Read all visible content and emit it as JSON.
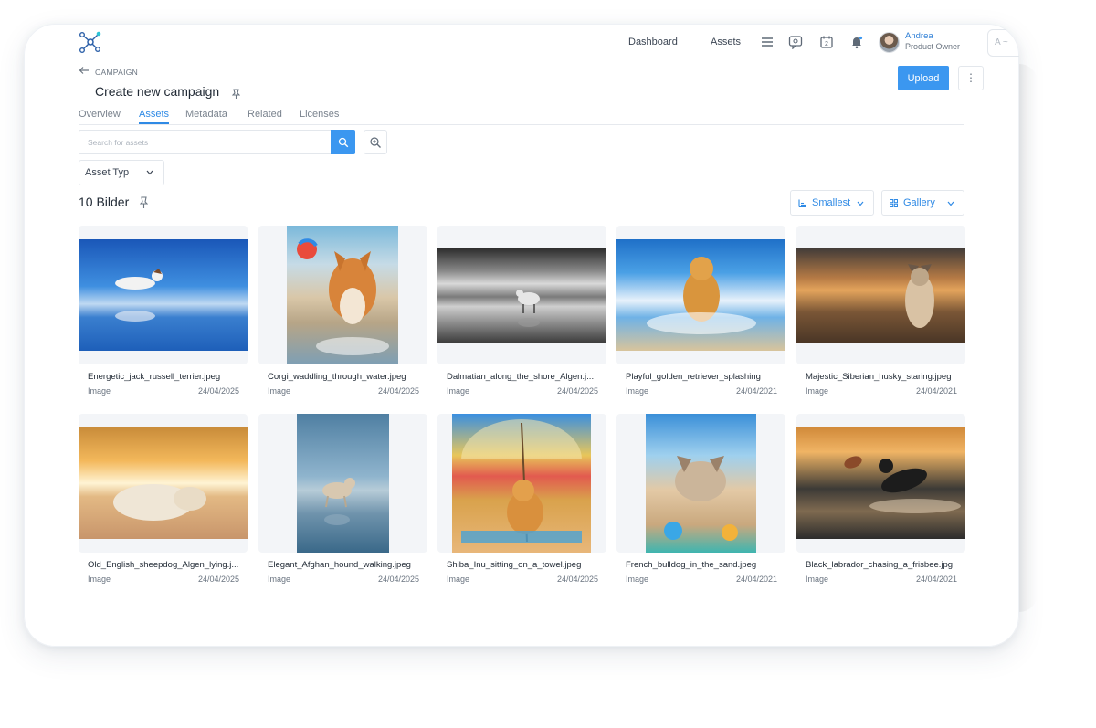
{
  "header": {
    "nav": [
      "Dashboard",
      "Assets"
    ],
    "user": {
      "name": "Andrea",
      "role": "Product Owner"
    },
    "language_pill": "A ~"
  },
  "breadcrumb": "CAMPAIGN",
  "page_title": "Create new campaign",
  "actions": {
    "upload": "Upload",
    "more": "⋮"
  },
  "tabs": [
    {
      "label": "Overview",
      "active": false
    },
    {
      "label": "Assets",
      "active": true
    },
    {
      "label": "Metadata",
      "active": false
    },
    {
      "label": "Related",
      "active": false
    },
    {
      "label": "Licenses",
      "active": false
    }
  ],
  "search": {
    "placeholder": "Search for assets"
  },
  "filters": {
    "asset_type": "Asset Typ"
  },
  "results": {
    "count_label": "10 Bilder",
    "sort": "Smallest",
    "view": "Gallery"
  },
  "assets": [
    {
      "filename": "Energetic_jack_russell_terrier.jpeg",
      "type": "Image",
      "date": "24/04/2025"
    },
    {
      "filename": "Corgi_waddling_through_water.jpeg",
      "type": "Image",
      "date": "24/04/2025"
    },
    {
      "filename": "Dalmatian_along_the_shore_Algen.j...",
      "type": "Image",
      "date": "24/04/2025"
    },
    {
      "filename": "Playful_golden_retriever_splashing",
      "type": "Image",
      "date": "24/04/2021"
    },
    {
      "filename": "Majestic_Siberian_husky_staring.jpeg",
      "type": "Image",
      "date": "24/04/2021"
    },
    {
      "filename": "Old_English_sheepdog_Algen_lying.j...",
      "type": "Image",
      "date": "24/04/2025"
    },
    {
      "filename": "Elegant_Afghan_hound_walking.jpeg",
      "type": "Image",
      "date": "24/04/2025"
    },
    {
      "filename": "Shiba_Inu_sitting_on_a_towel.jpeg",
      "type": "Image",
      "date": "24/04/2025"
    },
    {
      "filename": "French_bulldog_in_the_sand.jpeg",
      "type": "Image",
      "date": "24/04/2021"
    },
    {
      "filename": "Black_labrador_chasing_a_frisbee.jpg",
      "type": "Image",
      "date": "24/04/2021"
    }
  ],
  "colors": {
    "accent": "#3b97f0",
    "link": "#2f8ae5"
  },
  "icons": [
    "logo-icon",
    "menu-icon",
    "chat-icon",
    "calendar-icon",
    "bell-icon",
    "back-arrow-icon",
    "pin-icon",
    "search-icon",
    "ai-search-icon",
    "chevron-down-icon",
    "sort-icon",
    "gallery-icon"
  ]
}
